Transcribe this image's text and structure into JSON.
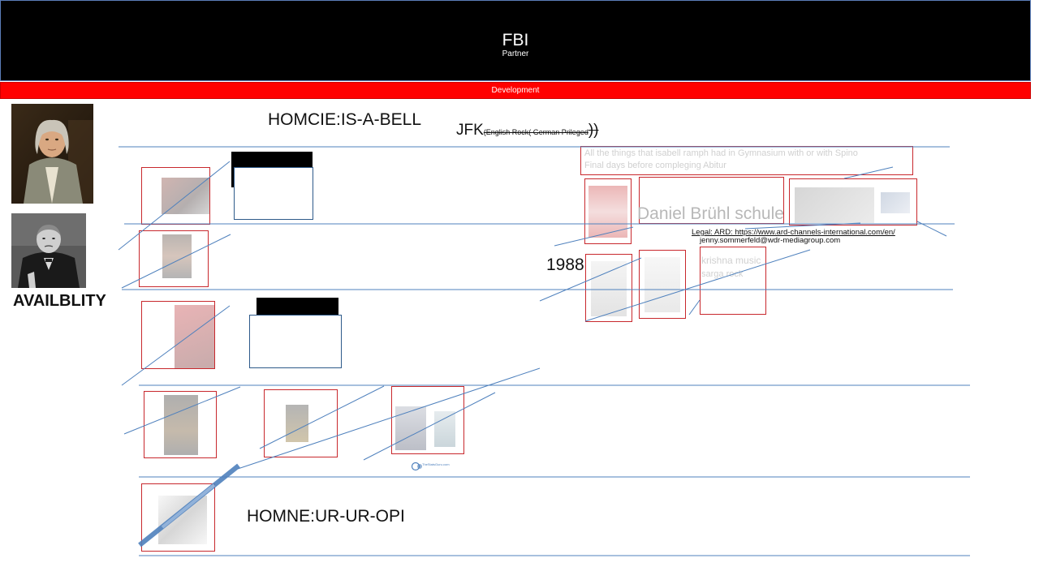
{
  "header": {
    "title": "FBI",
    "subtitle": "Partner"
  },
  "banner": {
    "label": "Development"
  },
  "sidebar": {
    "portraits": [
      {
        "name": "portrait-franklin"
      },
      {
        "name": "portrait-churchill"
      }
    ],
    "availability_label": "AVAILBLITY"
  },
  "labels": {
    "homcie": "HOMCIE:IS-A-BELL",
    "homne": "HOMNE:UR-UR-OPI",
    "jfk_main": "JFK",
    "jfk_sub": "(English Rock( German Prileged",
    "jfk_close": "))",
    "year": "1988",
    "daniel": "Daniel Brühl schule",
    "krishna_line1": "krishna music",
    "krishna_line2": "sarga rock"
  },
  "note": {
    "line1": "All the things that isabell ramph had in Gymnasium with or with Spino",
    "line2": "Final days before compleging Abitur"
  },
  "legal": {
    "line1": "Legal: ARD: https://www.ard-channels-international.com/en/",
    "line2": "jenny.sommerfeld@wdr-mediagroup.com"
  },
  "footer_logo": {
    "text": "TheStatsGuru.com"
  },
  "colors": {
    "header_bg": "#000000",
    "banner_bg": "#ff0000",
    "frame_border": "#c8282d",
    "connector": "#4f81bd",
    "box_border": "#2e5a8a"
  }
}
